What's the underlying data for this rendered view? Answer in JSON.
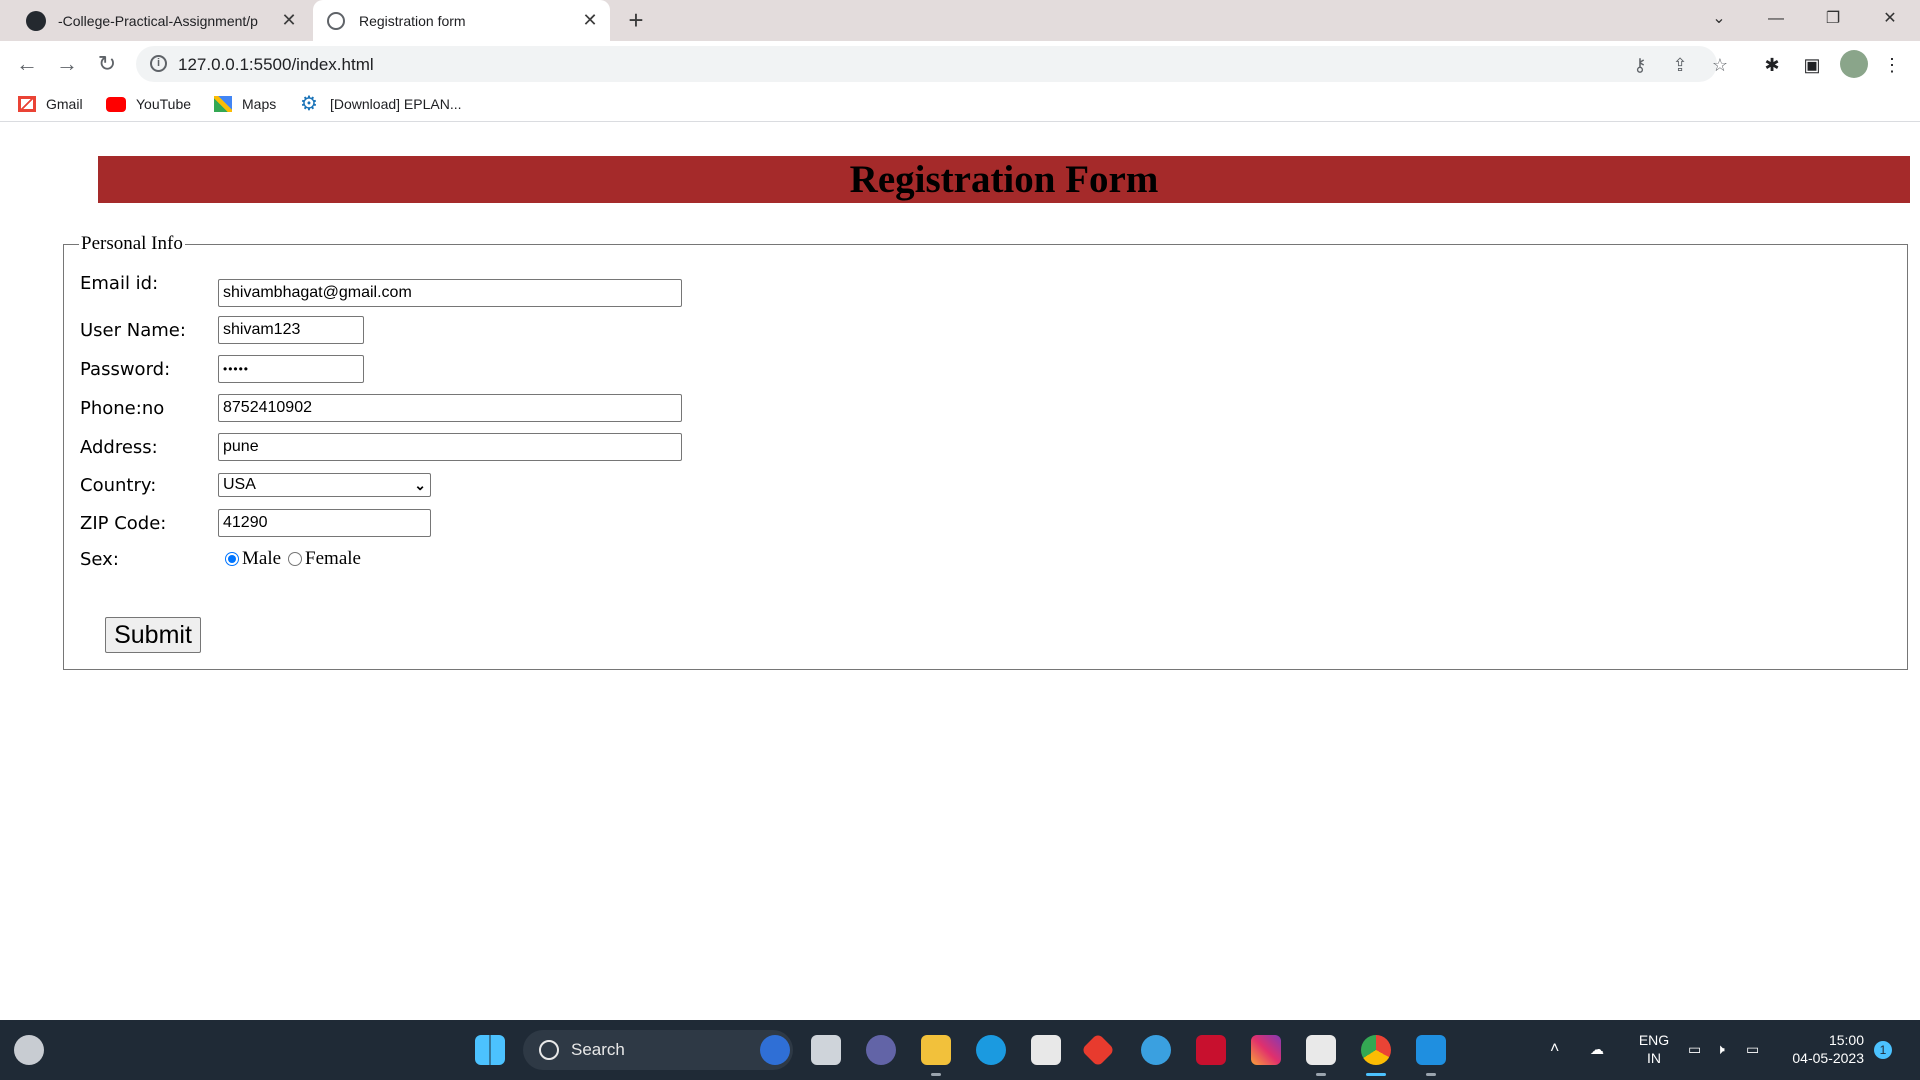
{
  "browser": {
    "tabs": [
      {
        "title": "-College-Practical-Assignment/p",
        "active": false
      },
      {
        "title": "Registration form",
        "active": true
      }
    ],
    "url": "127.0.0.1:5500/index.html",
    "bookmarks": [
      {
        "label": "Gmail",
        "icon": "gmail-icon"
      },
      {
        "label": "YouTube",
        "icon": "youtube-icon"
      },
      {
        "label": "Maps",
        "icon": "maps-icon"
      },
      {
        "label": "[Download] EPLAN...",
        "icon": "gear-icon"
      }
    ]
  },
  "page": {
    "title": "Registration Form",
    "banner_color": "#a52a2a",
    "legend": "Personal Info",
    "fields": {
      "email": {
        "label": "Email id:",
        "value": "shivambhagat@gmail.com"
      },
      "username": {
        "label": "User Name:",
        "value": "shivam123"
      },
      "password": {
        "label": "Password:",
        "value": "•••••"
      },
      "phone": {
        "label": "Phone:no",
        "value": "8752410902"
      },
      "address": {
        "label": "Address:",
        "value": "pune"
      },
      "country": {
        "label": "Country:",
        "value": "USA"
      },
      "zip": {
        "label": "ZIP Code:",
        "value": "41290"
      },
      "sex": {
        "label": "Sex:",
        "options": [
          "Male",
          "Female"
        ],
        "selected": "Male"
      }
    },
    "submit_label": "Submit"
  },
  "taskbar": {
    "search_label": "Search",
    "language": "ENG",
    "region": "IN",
    "time": "15:00",
    "date": "04-05-2023",
    "notification_count": "1"
  }
}
